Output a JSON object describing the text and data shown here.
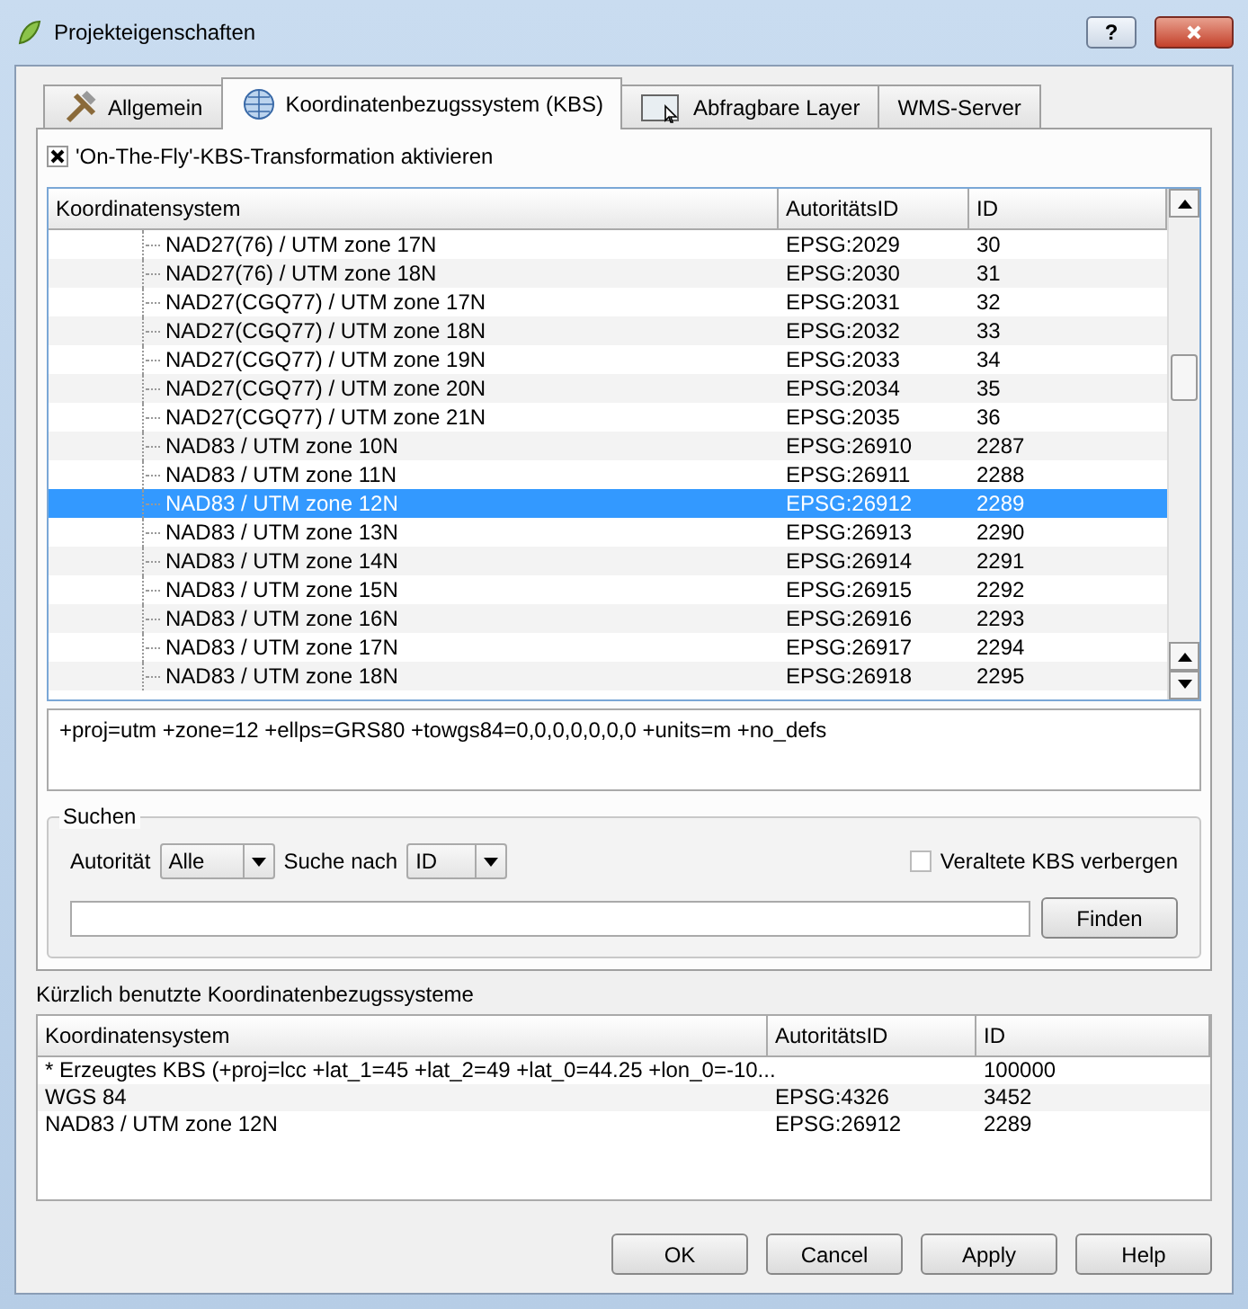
{
  "window": {
    "title": "Projekteigenschaften",
    "buttons": [
      "?"
    ]
  },
  "tabs": [
    {
      "label": "Allgemein",
      "selected": false
    },
    {
      "label": "Koordinatenbezugssystem (KBS)",
      "selected": true
    },
    {
      "label": "Abfragbare Layer",
      "selected": false
    },
    {
      "label": "WMS-Server",
      "selected": false
    }
  ],
  "on_the_fly": {
    "label": "'On-The-Fly'-KBS-Transformation aktivieren",
    "checked": true
  },
  "crs_table": {
    "columns": [
      "Koordinatensystem",
      "AutoritätsID",
      "ID"
    ],
    "rows": [
      {
        "name": "NAD27(76) / UTM zone 17N",
        "authority_id": "EPSG:2029",
        "id": "30",
        "selected": false
      },
      {
        "name": "NAD27(76) / UTM zone 18N",
        "authority_id": "EPSG:2030",
        "id": "31",
        "selected": false
      },
      {
        "name": "NAD27(CGQ77) / UTM zone 17N",
        "authority_id": "EPSG:2031",
        "id": "32",
        "selected": false
      },
      {
        "name": "NAD27(CGQ77) / UTM zone 18N",
        "authority_id": "EPSG:2032",
        "id": "33",
        "selected": false
      },
      {
        "name": "NAD27(CGQ77) / UTM zone 19N",
        "authority_id": "EPSG:2033",
        "id": "34",
        "selected": false
      },
      {
        "name": "NAD27(CGQ77) / UTM zone 20N",
        "authority_id": "EPSG:2034",
        "id": "35",
        "selected": false
      },
      {
        "name": "NAD27(CGQ77) / UTM zone 21N",
        "authority_id": "EPSG:2035",
        "id": "36",
        "selected": false
      },
      {
        "name": "NAD83 / UTM zone 10N",
        "authority_id": "EPSG:26910",
        "id": "2287",
        "selected": false
      },
      {
        "name": "NAD83 / UTM zone 11N",
        "authority_id": "EPSG:26911",
        "id": "2288",
        "selected": false
      },
      {
        "name": "NAD83 / UTM zone 12N",
        "authority_id": "EPSG:26912",
        "id": "2289",
        "selected": true
      },
      {
        "name": "NAD83 / UTM zone 13N",
        "authority_id": "EPSG:26913",
        "id": "2290",
        "selected": false
      },
      {
        "name": "NAD83 / UTM zone 14N",
        "authority_id": "EPSG:26914",
        "id": "2291",
        "selected": false
      },
      {
        "name": "NAD83 / UTM zone 15N",
        "authority_id": "EPSG:26915",
        "id": "2292",
        "selected": false
      },
      {
        "name": "NAD83 / UTM zone 16N",
        "authority_id": "EPSG:26916",
        "id": "2293",
        "selected": false
      },
      {
        "name": "NAD83 / UTM zone 17N",
        "authority_id": "EPSG:26917",
        "id": "2294",
        "selected": false
      },
      {
        "name": "NAD83 / UTM zone 18N",
        "authority_id": "EPSG:26918",
        "id": "2295",
        "selected": false
      }
    ]
  },
  "proj_definition": "+proj=utm +zone=12 +ellps=GRS80 +towgs84=0,0,0,0,0,0,0 +units=m +no_defs",
  "search": {
    "title": "Suchen",
    "authority_label": "Autorität",
    "authority_value": "Alle",
    "search_by_label": "Suche nach",
    "search_by_value": "ID",
    "hide_deprecated": {
      "label": "Veraltete KBS verbergen",
      "checked": false
    },
    "find_button": "Finden"
  },
  "recent": {
    "title": "Kürzlich benutzte Koordinatenbezugssysteme",
    "columns": [
      "Koordinatensystem",
      "AutoritätsID",
      "ID"
    ],
    "rows": [
      {
        "name": " * Erzeugtes KBS (+proj=lcc +lat_1=45 +lat_2=49 +lat_0=44.25 +lon_0=-10...",
        "id": "100000"
      },
      {
        "name": "WGS 84",
        "authority_id": "EPSG:4326",
        "id": "3452"
      },
      {
        "name": "NAD83 / UTM zone 12N",
        "authority_id": "EPSG:26912",
        "id": "2289"
      }
    ]
  },
  "buttons": [
    "OK",
    "Cancel",
    "Apply",
    "Help"
  ]
}
